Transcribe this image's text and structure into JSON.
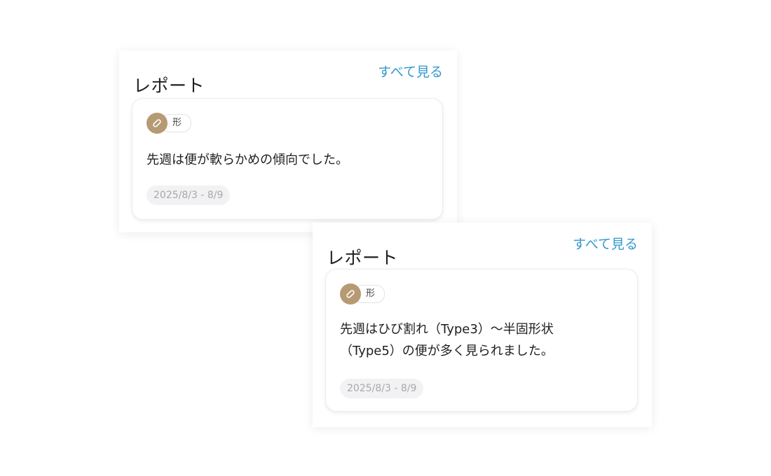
{
  "colors": {
    "accent": "#3399cc",
    "tag_icon_bg": "#b59a73",
    "date_chip_bg": "#f2f2f4",
    "date_chip_text": "#a8a8ac"
  },
  "panels": [
    {
      "title": "レポート",
      "see_all": "すべて見る",
      "card": {
        "tag_icon": "capsule-icon",
        "tag_label": "形",
        "text": "先週は便が軟らかめの傾向でした。",
        "date_range": "2025/8/3 - 8/9"
      }
    },
    {
      "title": "レポート",
      "see_all": "すべて見る",
      "card": {
        "tag_icon": "capsule-icon",
        "tag_label": "形",
        "text_line1": "先週はひび割れ（Type3）〜半固形状",
        "text_line2": "（Type5）の便が多く見られました。",
        "date_range": "2025/8/3 - 8/9"
      }
    }
  ]
}
